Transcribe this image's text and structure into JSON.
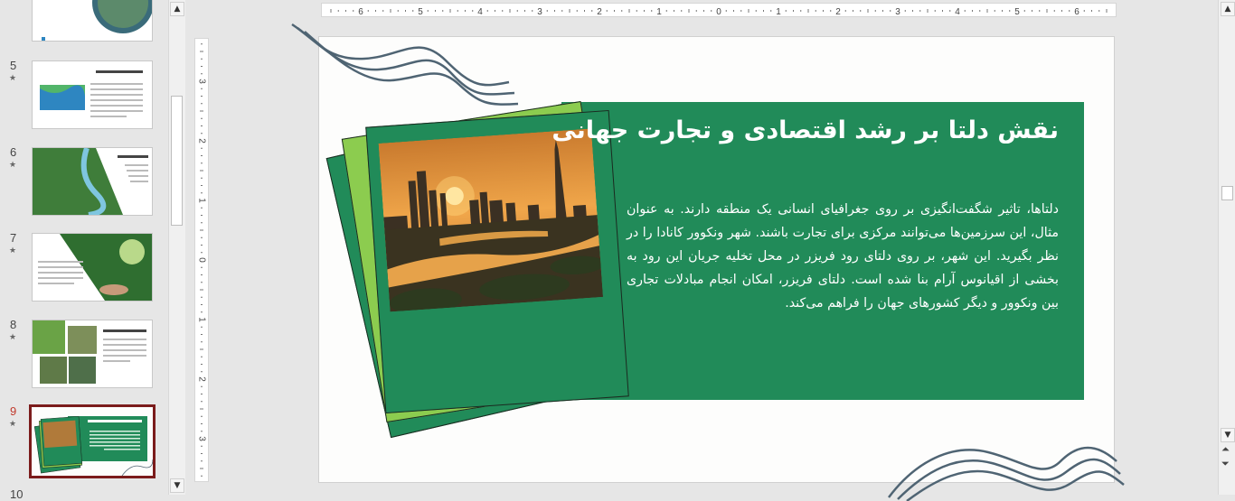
{
  "thumbnails": [
    {
      "number": "",
      "starred": false
    },
    {
      "number": "5",
      "starred": true,
      "title": "دلتا چگونه تشکیل می‌شود؟"
    },
    {
      "number": "6",
      "starred": true,
      "title": "شرایط تشکیل دلتا"
    },
    {
      "number": "7",
      "starred": true,
      "title": "اهمیت دلتا در زیست‌بوم"
    },
    {
      "number": "8",
      "starred": true,
      "title": "نقش دلتا در توسعه صنعت کشاورزی"
    },
    {
      "number": "9",
      "starred": true,
      "active": true,
      "title": "نقش دلتا بر رشد اقتصادی و تجارت جهانی"
    },
    {
      "number": "10",
      "starred": false
    }
  ],
  "ruler": {
    "horizontal_labels": [
      "6",
      "5",
      "4",
      "3",
      "2",
      "1",
      "0",
      "1",
      "2",
      "3",
      "4",
      "5",
      "6"
    ],
    "vertical_labels": [
      "3",
      "2",
      "1",
      "0",
      "1",
      "2",
      "3"
    ]
  },
  "slide": {
    "title": "نقش دلتا بر رشد اقتصادی و تجارت جهانی",
    "body": "دلتاها، تاثیر شگفت‌انگیزی بر روی جغرافیای انسانی یک منطقه دارند. به عنوان مثال، این سرزمین‌ها می‌توانند مرکزی برای تجارت باشند. شهر ونکوور کانادا را در نظر بگیرید. این شهر، بر روی دلتای رود فریزر در محل تخلیه جریان این رود به بخشی از اقیانوس آرام بنا شده است. دلتای فریزر، امکان انجام مبادلات تجاری بین ونکوور و دیگر کشورهای جهان را فراهم می‌کند.",
    "image_alt": "sunset-city-river-photo"
  },
  "colors": {
    "panel_green": "#218b59",
    "card_light_green": "#8ccc4f",
    "card_dark_green": "#218b59",
    "wave_lines": "#4f6473",
    "active_thumb_border": "#7b1b1b"
  },
  "icons": {
    "scroll_up": "▲",
    "scroll_down": "▼",
    "prev_slide": "⏶",
    "next_slide": "⏷"
  }
}
